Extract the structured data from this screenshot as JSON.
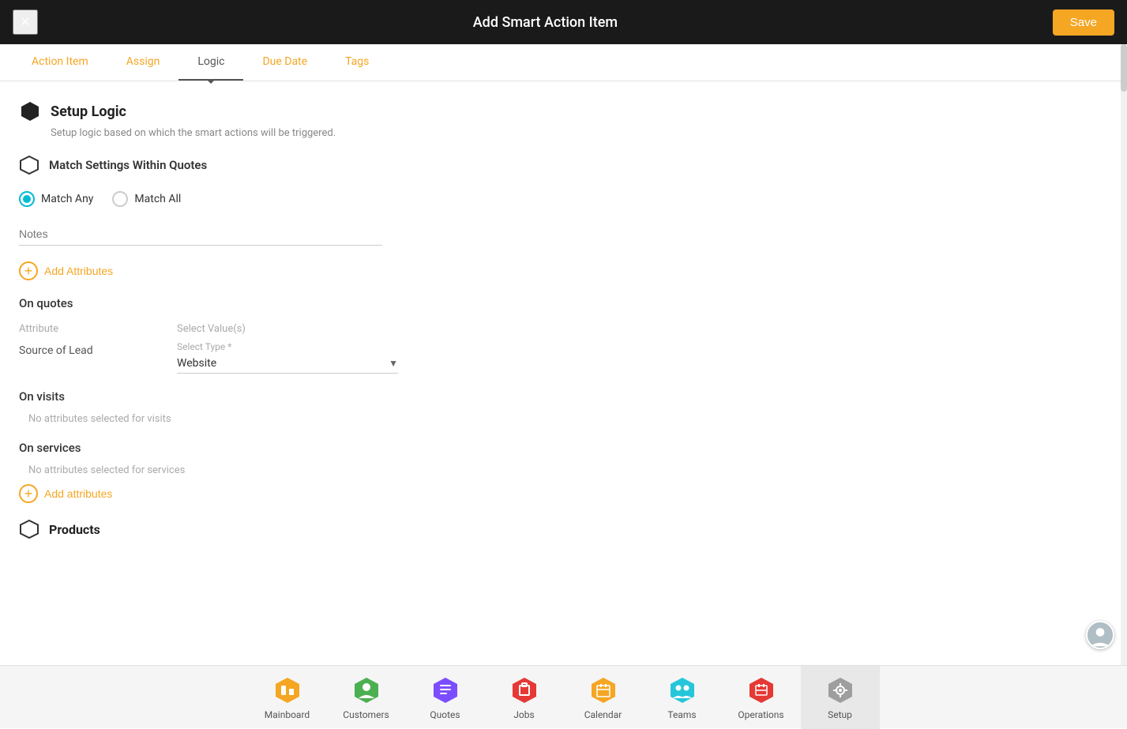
{
  "header": {
    "title": "Add Smart Action Item",
    "close_label": "×",
    "save_label": "Save"
  },
  "tabs": [
    {
      "id": "action-item",
      "label": "Action Item",
      "active": false
    },
    {
      "id": "assign",
      "label": "Assign",
      "active": false
    },
    {
      "id": "logic",
      "label": "Logic",
      "active": true
    },
    {
      "id": "due-date",
      "label": "Due Date",
      "active": false
    },
    {
      "id": "tags",
      "label": "Tags",
      "active": false
    }
  ],
  "setup_logic": {
    "title": "Setup Logic",
    "subtitle": "Setup logic based on which the smart actions will be triggered."
  },
  "match_settings": {
    "title": "Match Settings Within Quotes",
    "match_any_label": "Match Any",
    "match_all_label": "Match All",
    "match_any_selected": true,
    "notes_placeholder": "Notes"
  },
  "add_attributes": {
    "label": "Add Attributes"
  },
  "on_quotes": {
    "section_label": "On quotes",
    "attribute_header": "Attribute",
    "select_values_label": "Select Value(s)",
    "source_label": "Source of Lead",
    "select_type_label": "Select Type *",
    "select_type_value": "Website"
  },
  "on_visits": {
    "section_label": "On visits",
    "no_attributes_text": "No attributes selected for visits"
  },
  "on_services": {
    "section_label": "On services",
    "no_attributes_text": "No attributes selected for services"
  },
  "add_attributes_2": {
    "label": "Add attributes"
  },
  "products": {
    "title": "Products"
  },
  "bottom_nav": [
    {
      "id": "mainboard",
      "label": "Mainboard",
      "color": "#f5a623",
      "icon": "mainboard"
    },
    {
      "id": "customers",
      "label": "Customers",
      "color": "#4caf50",
      "icon": "customers"
    },
    {
      "id": "quotes",
      "label": "Quotes",
      "color": "#7c4dff",
      "icon": "quotes"
    },
    {
      "id": "jobs",
      "label": "Jobs",
      "color": "#e53935",
      "icon": "jobs"
    },
    {
      "id": "calendar",
      "label": "Calendar",
      "color": "#f5a623",
      "icon": "calendar"
    },
    {
      "id": "teams",
      "label": "Teams",
      "color": "#26c6da",
      "icon": "teams"
    },
    {
      "id": "operations",
      "label": "Operations",
      "color": "#e53935",
      "icon": "operations"
    },
    {
      "id": "setup",
      "label": "Setup",
      "color": "#9e9e9e",
      "icon": "setup",
      "active": true
    }
  ]
}
